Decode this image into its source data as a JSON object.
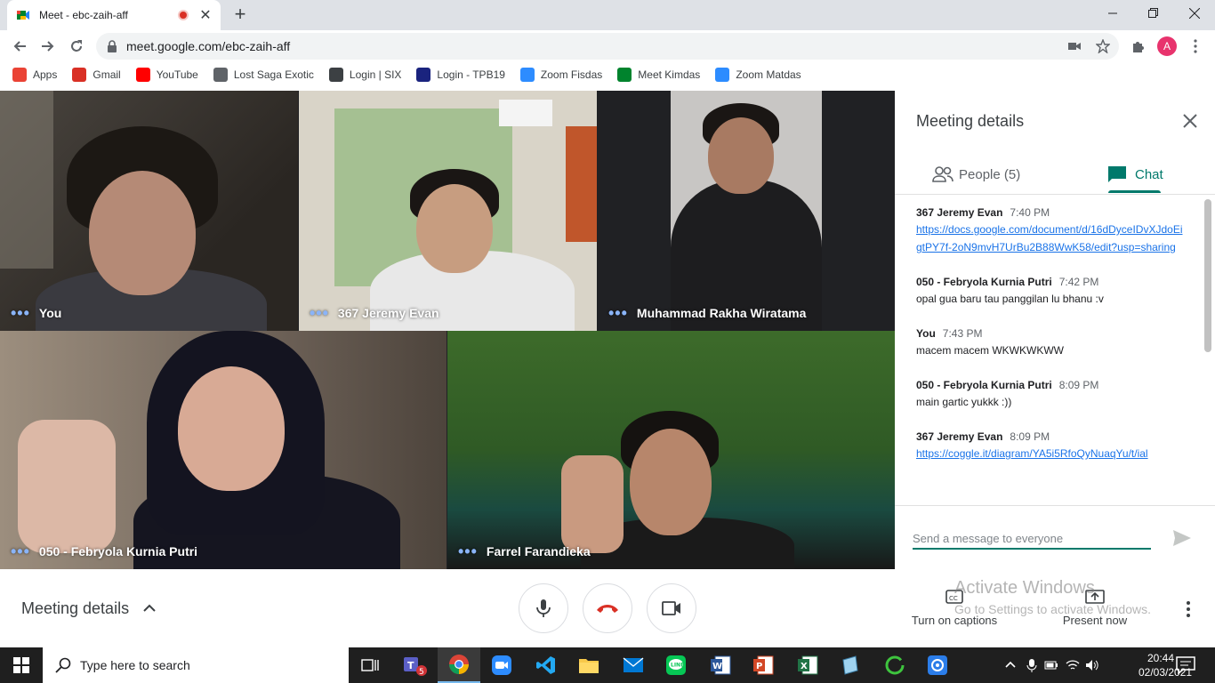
{
  "browser": {
    "tab_title": "Meet - ebc-zaih-aff",
    "url": "meet.google.com/ebc-zaih-aff",
    "avatar_letter": "A"
  },
  "bookmarks": [
    {
      "label": "Apps",
      "icon": "apps-grid-icon",
      "color": "#ea4335"
    },
    {
      "label": "Gmail",
      "icon": "gmail-icon",
      "color": "#d93025"
    },
    {
      "label": "YouTube",
      "icon": "youtube-icon",
      "color": "#ff0000"
    },
    {
      "label": "Lost Saga Exotic",
      "icon": "globe-icon",
      "color": "#5f6368"
    },
    {
      "label": "Login | SIX",
      "icon": "six-icon",
      "color": "#3c4043"
    },
    {
      "label": "Login - TPB19",
      "icon": "tpb-icon",
      "color": "#1a237e"
    },
    {
      "label": "Zoom Fisdas",
      "icon": "zoom-icon",
      "color": "#2d8cff"
    },
    {
      "label": "Meet Kimdas",
      "icon": "meet-icon",
      "color": "#00832d"
    },
    {
      "label": "Zoom Matdas",
      "icon": "zoom-icon",
      "color": "#2d8cff"
    }
  ],
  "participants": [
    {
      "name": "You"
    },
    {
      "name": "367 Jeremy Evan"
    },
    {
      "name": "Muhammad Rakha Wiratama"
    },
    {
      "name": "050 - Febryola Kurnia Putri"
    },
    {
      "name": "Farrel Farandieka"
    }
  ],
  "panel": {
    "title": "Meeting details",
    "people_tab": "People (5)",
    "chat_tab": "Chat",
    "input_placeholder": "Send a message to everyone"
  },
  "chat": [
    {
      "sender": "367 Jeremy Evan",
      "time": "7:40 PM",
      "text": "https://docs.google.com/document/d/16dDyceIDvXJdoEigtPY7f-2oN9mvH7UrBu2B88WwK58/edit?usp=sharing",
      "link": true
    },
    {
      "sender": "050 - Febryola Kurnia Putri",
      "time": "7:42 PM",
      "text": "opal gua baru tau panggilan lu bhanu :v",
      "link": false
    },
    {
      "sender": "You",
      "time": "7:43 PM",
      "text": "macem macem WKWKWKWW",
      "link": false
    },
    {
      "sender": "050 - Febryola Kurnia Putri",
      "time": "8:09 PM",
      "text": "main gartic yukkk :))",
      "link": false
    },
    {
      "sender": "367 Jeremy Evan",
      "time": "8:09 PM",
      "text": "https://coggle.it/diagram/YA5i5RfoQyNuaqYu/t/ial",
      "link": true
    }
  ],
  "bottom": {
    "meeting_details": "Meeting details",
    "captions": "Turn on captions",
    "present": "Present now"
  },
  "watermark": {
    "line1": "Activate Windows",
    "line2": "Go to Settings to activate Windows."
  },
  "taskbar": {
    "search_placeholder": "Type here to search",
    "time": "20:44",
    "date": "02/03/2021",
    "teams_badge": "5"
  }
}
